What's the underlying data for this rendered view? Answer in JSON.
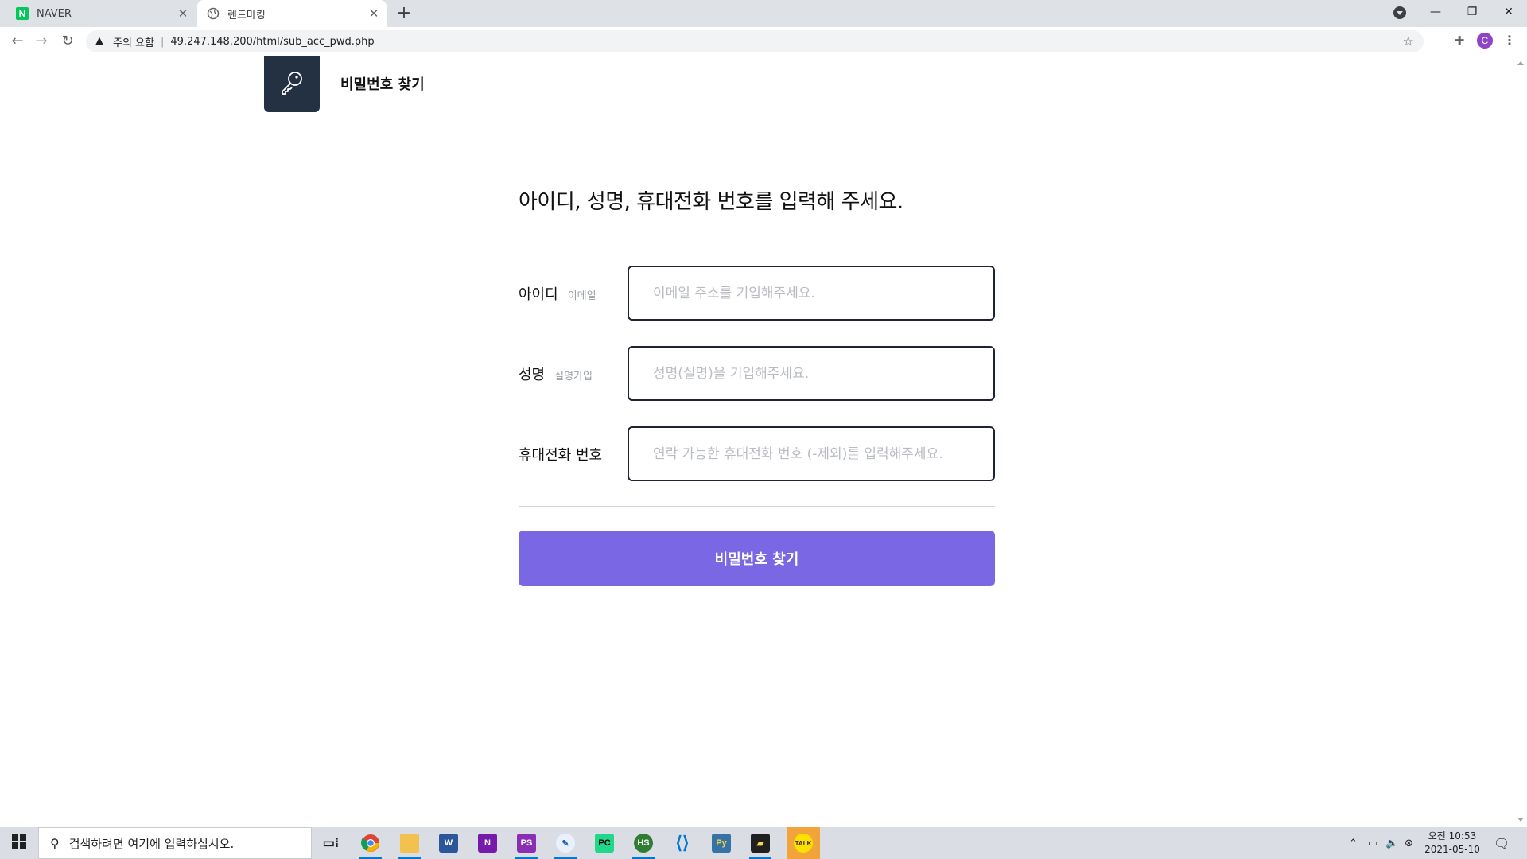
{
  "browser": {
    "tabs": [
      {
        "title": "NAVER",
        "favicon": "naver-icon",
        "active": false
      },
      {
        "title": "렌드마킹",
        "favicon": "globe-icon",
        "active": true
      }
    ],
    "new_tab_label": "+",
    "security_warning": "주의 요함",
    "url_separator": "|",
    "url": "49.247.148.200/html/sub_acc_pwd.php",
    "profile_initial": "C"
  },
  "header": {
    "title": "비밀번호 찾기",
    "logo_icon": "key-icon",
    "logo_bg": "#243142"
  },
  "form": {
    "headline": "아이디, 성명, 휴대전화 번호를 입력해 주세요.",
    "fields": [
      {
        "label": "아이디",
        "sublabel": "이메일",
        "placeholder": "이메일 주소를 기입해주세요.",
        "value": ""
      },
      {
        "label": "성명",
        "sublabel": "실명가입",
        "placeholder": "성명(실명)을 기입해주세요.",
        "value": ""
      },
      {
        "label": "휴대전화 번호",
        "sublabel": "",
        "placeholder": "연락 가능한 휴대전화 번호 (-제외)를 입력해주세요.",
        "value": ""
      }
    ],
    "submit_label": "비밀번호 찾기",
    "accent_color": "#7967e3"
  },
  "taskbar": {
    "search_placeholder": "검색하려면 여기에 입력하십시오.",
    "apps": [
      "task-view-icon",
      "chrome-icon",
      "file-explorer-icon",
      "word-icon",
      "onenote-icon",
      "phpstorm-icon",
      "wordpad-icon",
      "pycharm-icon",
      "hancom-icon",
      "vscode-icon",
      "python-icon",
      "sticky-notes-icon",
      "kakaotalk-icon"
    ],
    "clock": {
      "period_time": "오전 10:53",
      "date": "2021-05-10"
    }
  }
}
